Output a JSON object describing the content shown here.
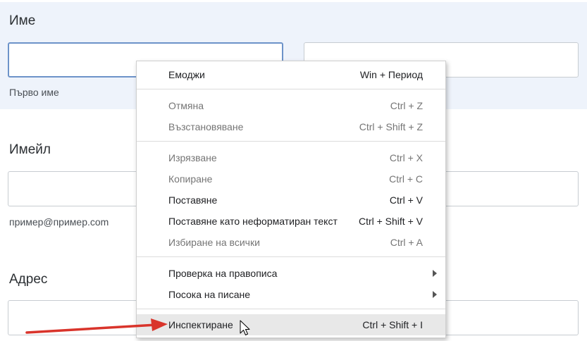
{
  "form": {
    "name": {
      "title": "Име",
      "first_hint": "Първо име"
    },
    "email": {
      "title": "Имейл",
      "hint": "пример@пример.com"
    },
    "address": {
      "title": "Адрес"
    }
  },
  "context_menu": {
    "emoji": {
      "label": "Емоджи",
      "shortcut": "Win + Период"
    },
    "undo": {
      "label": "Отмяна",
      "shortcut": "Ctrl + Z"
    },
    "redo": {
      "label": "Възстановяване",
      "shortcut": "Ctrl + Shift + Z"
    },
    "cut": {
      "label": "Изрязване",
      "shortcut": "Ctrl + X"
    },
    "copy": {
      "label": "Копиране",
      "shortcut": "Ctrl + C"
    },
    "paste": {
      "label": "Поставяне",
      "shortcut": "Ctrl + V"
    },
    "paste_plain": {
      "label": "Поставяне като неформатиран текст",
      "shortcut": "Ctrl + Shift + V"
    },
    "select_all": {
      "label": "Избиране на всички",
      "shortcut": "Ctrl + A"
    },
    "spellcheck": {
      "label": "Проверка на правописа"
    },
    "writing_direction": {
      "label": "Посока на писане"
    },
    "inspect": {
      "label": "Инспектиране",
      "shortcut": "Ctrl + Shift + I"
    }
  },
  "colors": {
    "annotation_arrow": "#d9342b",
    "focus_border": "#6d93c9",
    "section_background": "#eef3fb"
  }
}
